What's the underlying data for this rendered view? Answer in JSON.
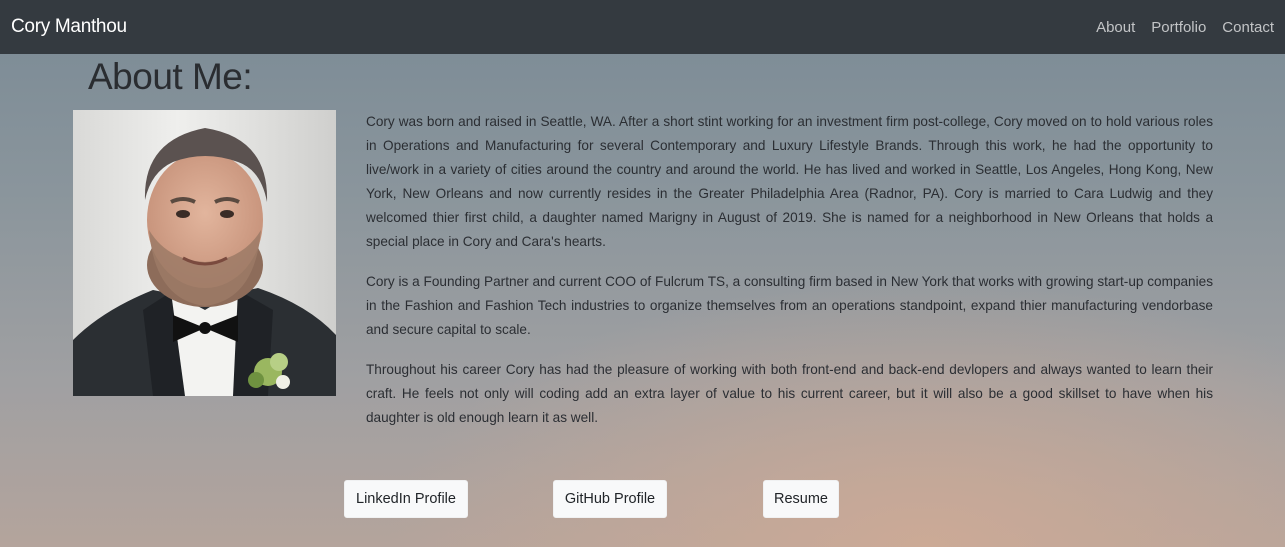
{
  "nav": {
    "brand": "Cory Manthou",
    "links": [
      "About",
      "Portfolio",
      "Contact"
    ]
  },
  "page": {
    "heading": "About Me:",
    "photo_alt": "portrait-photo"
  },
  "bio": {
    "paragraphs": [
      "Cory was born and raised in Seattle, WA. After a short stint working for an investment firm post-college, Cory moved on to hold various roles in Operations and Manufacturing for several Contemporary and Luxury Lifestyle Brands. Through this work, he had the opportunity to live/work in a variety of cities around the country and around the world. He has lived and worked in Seattle, Los Angeles, Hong Kong, New York, New Orleans and now currently resides in the Greater Philadelphia Area (Radnor, PA). Cory is married to Cara Ludwig and they welcomed thier first child, a daughter named Marigny in August of 2019. She is named for a neighborhood in New Orleans that holds a special place in Cory and Cara's hearts.",
      "Cory is a Founding Partner and current COO of Fulcrum TS, a consulting firm based in New York that works with growing start-up companies in the Fashion and Fashion Tech industries to organize themselves from an operations standpoint, expand thier manufacturing vendorbase and secure capital to scale.",
      "Throughout his career Cory has had the pleasure of working with both front-end and back-end devlopers and always wanted to learn their craft. He feels not only will coding add an extra layer of value to his current career, but it will also be a good skillset to have when his daughter is old enough learn it as well."
    ]
  },
  "buttons": {
    "linkedin": "LinkedIn Profile",
    "github": "GitHub Profile",
    "resume": "Resume"
  },
  "colors": {
    "navbar": "#343a40",
    "brand_text": "#ffffff",
    "nav_link": "#c2c4c6",
    "button_bg": "#f8f9fa"
  }
}
